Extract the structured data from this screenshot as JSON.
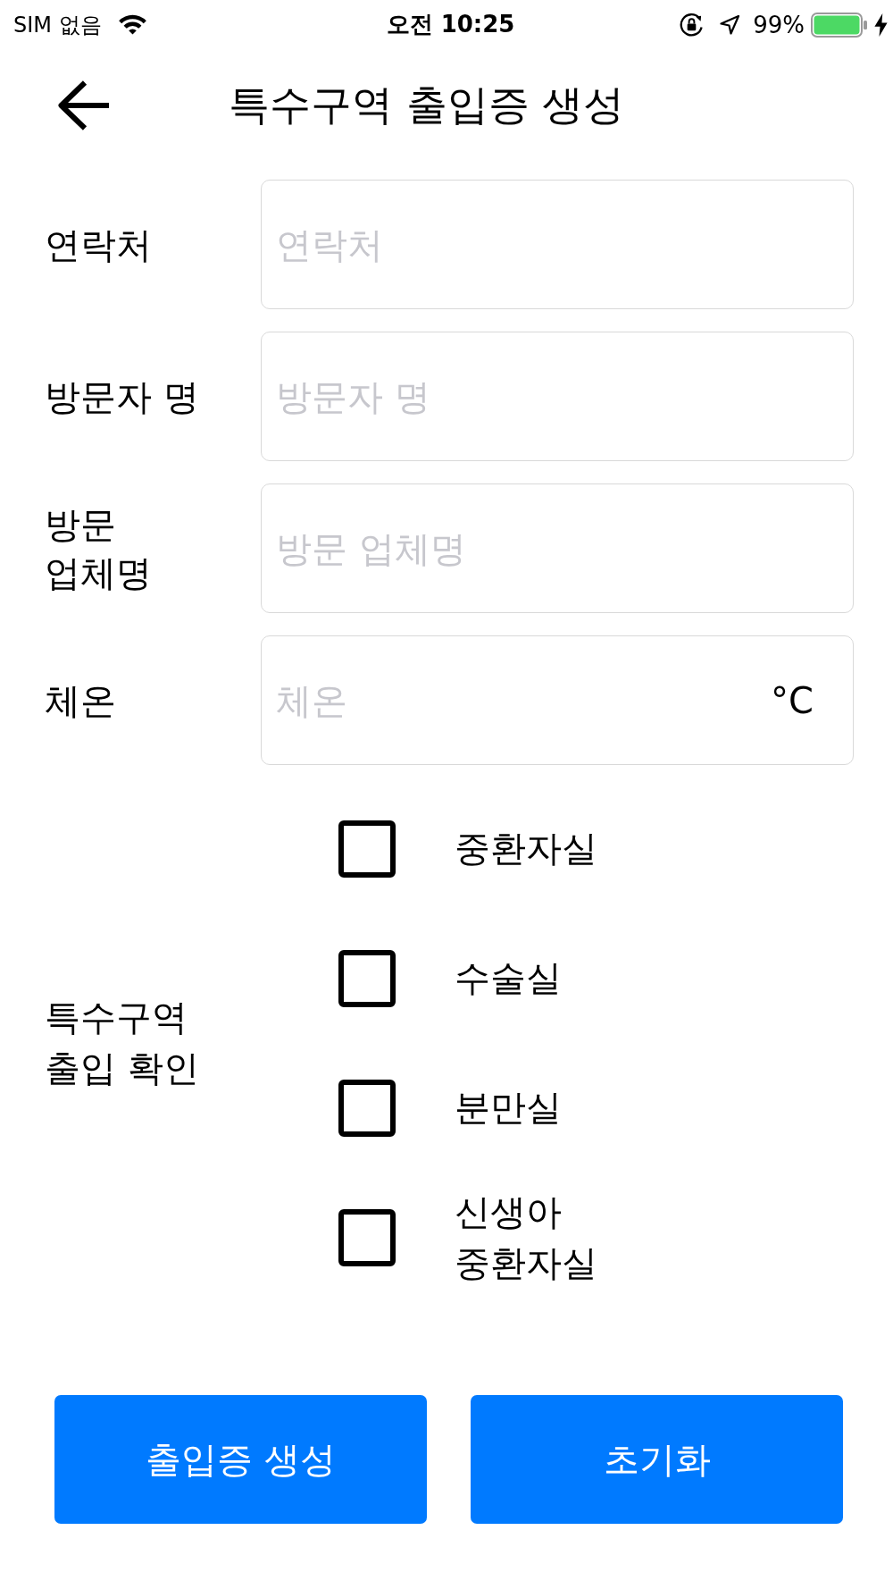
{
  "status_bar": {
    "carrier": "SIM 없음",
    "time": "오전 10:25",
    "battery_percent": "99%"
  },
  "header": {
    "title": "특수구역 출입증 생성"
  },
  "fields": [
    {
      "label": "연락처",
      "placeholder": "연락처"
    },
    {
      "label": "방문자 명",
      "placeholder": "방문자 명"
    },
    {
      "label": "방문\n업체명",
      "placeholder": "방문 업체명"
    },
    {
      "label": "체온",
      "placeholder": "체온",
      "unit": "°C"
    }
  ],
  "zone_check": {
    "label": "특수구역\n출입 확인",
    "options": [
      {
        "label": "중환자실",
        "checked": false
      },
      {
        "label": "수술실",
        "checked": false
      },
      {
        "label": "분만실",
        "checked": false
      },
      {
        "label": "신생아\n중환자실",
        "checked": false
      }
    ]
  },
  "buttons": [
    {
      "label": "출입증 생성"
    },
    {
      "label": "초기화"
    }
  ]
}
